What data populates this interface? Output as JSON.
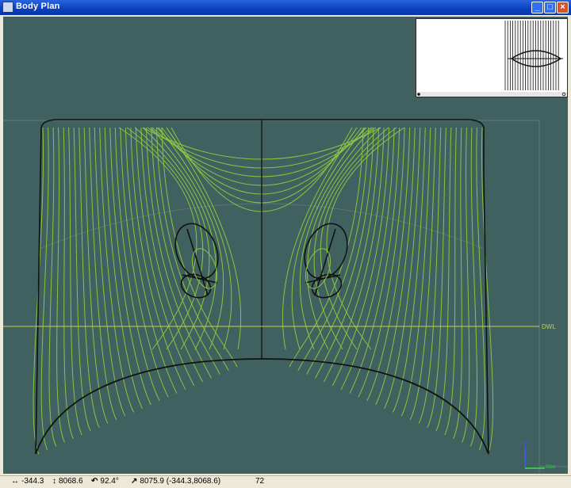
{
  "window": {
    "title": "Body Plan",
    "minimize_glyph": "_",
    "maximize_glyph": "□",
    "close_glyph": "×"
  },
  "viewport": {
    "waterline_label": "DWL",
    "axis_up_label": "Up",
    "axis_stbd_label": "Stbd"
  },
  "status": {
    "x_value": "-344.3",
    "y_value": "8068.6",
    "angle_value": "92.4°",
    "distance_value": "8075.9 (-344.3,8068.6)",
    "count_value": "72"
  },
  "colors": {
    "background": "#40615f",
    "section_lines": "#8ac443",
    "hull_outline": "#111111",
    "waterline": "#c8cf45"
  }
}
